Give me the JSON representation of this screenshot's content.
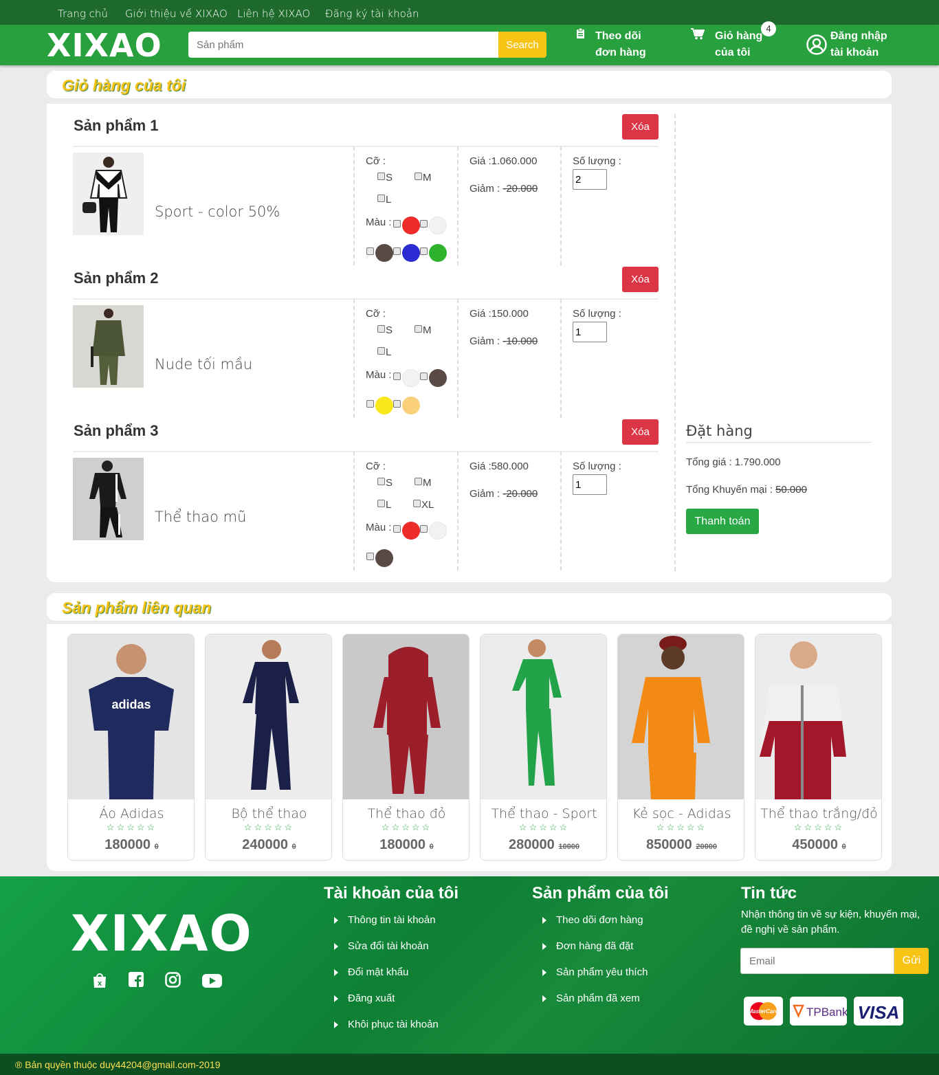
{
  "topnav": [
    "Trang chủ",
    "Giới thiệu về XIXAO",
    "Liên hệ XIXAO",
    "Đăng ký tài khoản"
  ],
  "header": {
    "logo": "XIXAO",
    "search_placeholder": "Sản phẩm",
    "search_button": "Search",
    "track_line1": "Theo dõi",
    "track_line2": "đơn hàng",
    "cart_line1": "Giỏ hàng",
    "cart_line2": "của tôi",
    "cart_count": "4",
    "login_line1": "Đăng nhập",
    "login_line2": "tài khoản"
  },
  "cart": {
    "title": "Giỏ hàng của tôi",
    "delete_label": "Xóa",
    "size_label": "Cỡ :",
    "color_label": "Màu :",
    "qty_label": "Số lượng :",
    "items": [
      {
        "title": "Sản phẩm 1",
        "name": "Sport - color 50%",
        "price": "Giá :1.060.000",
        "discount_label": "Giảm : ",
        "discount": "-20.000",
        "qty": "2",
        "sizes": [
          "S",
          "M",
          "L"
        ],
        "colors": [
          "#ee2b2b",
          "#f2f2f2",
          "#5a4a46",
          "#2a2bd0",
          "#2fb32f"
        ]
      },
      {
        "title": "Sản phẩm 2",
        "name": "Nude tối mầu",
        "price": "Giá :150.000",
        "discount_label": "Giảm : ",
        "discount": "-10.000",
        "qty": "1",
        "sizes": [
          "S",
          "M",
          "L"
        ],
        "colors": [
          "#f2f2f2",
          "#5a4a46",
          "#f8e81c",
          "#fbd07a"
        ]
      },
      {
        "title": "Sản phẩm 3",
        "name": "Thể thao mũ",
        "price": "Giá :580.000",
        "discount_label": "Giảm : ",
        "discount": "-20.000",
        "qty": "1",
        "sizes": [
          "S",
          "M",
          "L",
          "XL"
        ],
        "colors": [
          "#ee2b2b",
          "#f2f2f2",
          "#5a4a46"
        ]
      }
    ]
  },
  "order": {
    "title": "Đặt hàng",
    "total": "Tổng giá : 1.790.000",
    "promo_label": "Tổng Khuyến mại : ",
    "promo_value": "50.000",
    "pay_button": "Thanh toán"
  },
  "related": {
    "title": "Sản phẩm liên quan",
    "products": [
      {
        "name": "Áo Adidas",
        "price": "180000",
        "old": "0",
        "garment": "#1f2b5e"
      },
      {
        "name": "Bộ thể thao",
        "price": "240000",
        "old": "0",
        "garment": "#1b2048"
      },
      {
        "name": "Thể thao đỏ",
        "price": "180000",
        "old": "0",
        "garment": "#9c1e2a"
      },
      {
        "name": "Thể thao - Sport",
        "price": "280000",
        "old": "10000",
        "garment": "#22a34a"
      },
      {
        "name": "Kẻ sọc - Adidas",
        "price": "850000",
        "old": "20000",
        "garment": "#f38a14"
      },
      {
        "name": "Thể thao trắng/đỏ",
        "price": "450000",
        "old": "0",
        "garment": "#a3172a"
      }
    ],
    "stars": "☆☆☆☆☆"
  },
  "footer": {
    "logo": "XIXAO",
    "account_title": "Tài khoản của tôi",
    "account_links": [
      "Thông tin tài khoản",
      "Sửa đổi tài khoản",
      "Đổi mật khẩu",
      "Đăng xuất",
      "Khôi phục tài khoản"
    ],
    "products_title": "Sản phẩm của tôi",
    "product_links": [
      "Theo dõi đơn hàng",
      "Đơn hàng đã đặt",
      "Sản phẩm yêu thích",
      "Sản phẩm đã xem"
    ],
    "news_title": "Tin tức",
    "news_text": "Nhận thông tin về sự kiện, khuyến mại, đề nghị về sản phẩm.",
    "email_placeholder": "Email",
    "send_button": "Gửi",
    "payment": [
      "MasterCard",
      "TPBank",
      "VISA"
    ],
    "copyright": "® Bản quyền thuộc duy44204@gmail.com-2019"
  },
  "colors": {
    "brand_green": "#27a03d",
    "dark_green": "#1d6a2c",
    "accent_yellow": "#f7c416",
    "danger": "#dc3545"
  }
}
